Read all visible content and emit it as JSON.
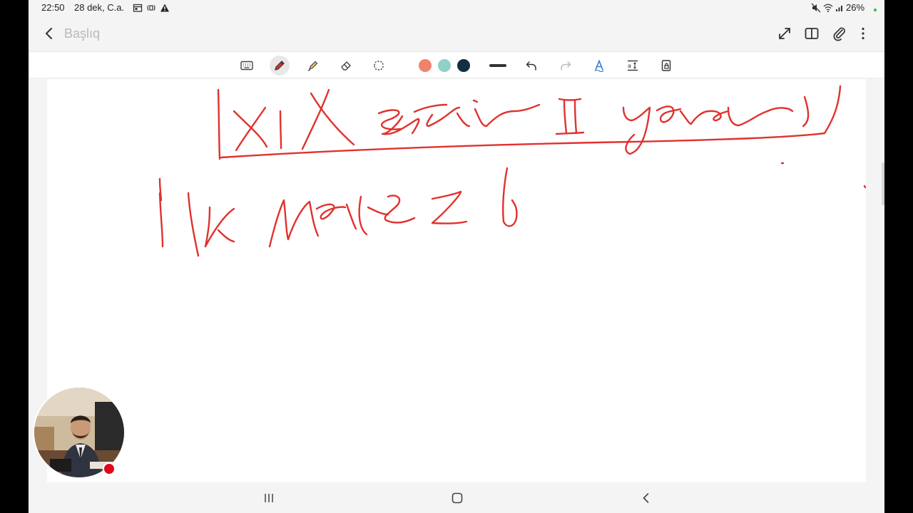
{
  "status_bar": {
    "time": "22:50",
    "date": "28 dek, C.a.",
    "battery": "26%",
    "icons": [
      "calendar-icon",
      "nfc-icon",
      "warning-icon",
      "mute-icon",
      "wifi-icon",
      "signal-icon"
    ]
  },
  "app_bar": {
    "title_placeholder": "Başlıq",
    "icons": [
      "back-icon",
      "expand-icon",
      "book-icon",
      "attach-icon",
      "more-icon"
    ]
  },
  "toolbar": {
    "tools": [
      "keyboard-icon",
      "pen-icon",
      "highlighter-icon",
      "eraser-icon",
      "lasso-icon",
      "pen-thickness-icon",
      "undo-icon",
      "redo-icon",
      "handwriting-to-text-icon",
      "text-spacing-icon",
      "lock-icon"
    ],
    "selected_tool": "pen-icon",
    "pen_colors": [
      "#f0826c",
      "#8ed1c6",
      "#12303f"
    ],
    "ink_color": "#e0322e"
  },
  "navigation_bar": {
    "icons": [
      "recent-apps-icon",
      "home-icon",
      "back-nav-icon"
    ]
  },
  "overlay": {
    "webcam": "presenter-video",
    "recording_indicator_color": "#e0061b"
  }
}
